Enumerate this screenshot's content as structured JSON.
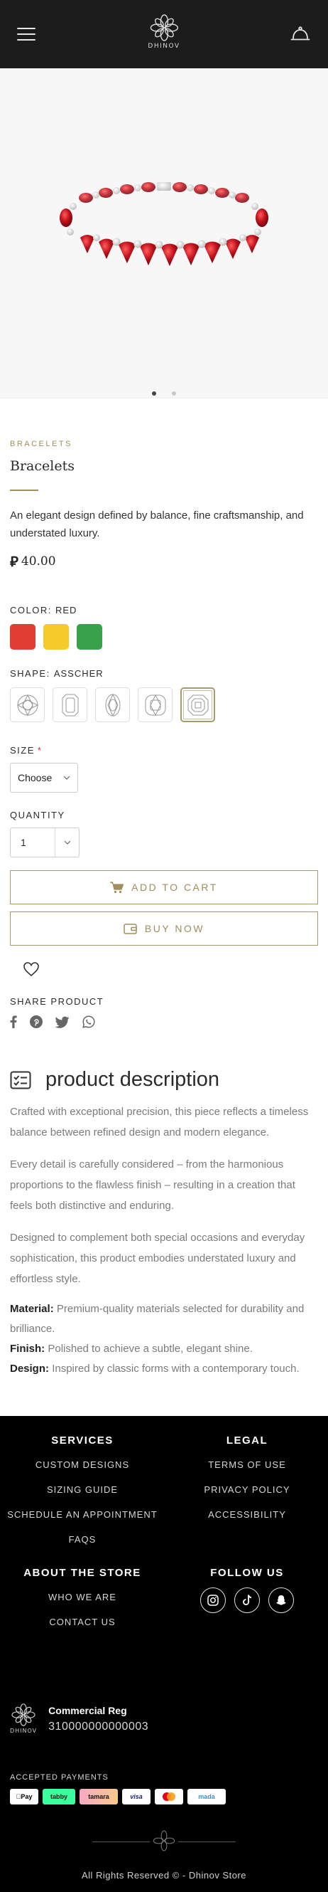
{
  "header": {
    "brand": "DHINOV"
  },
  "product": {
    "category": "BRACELETS",
    "title": "Bracelets",
    "description": "An elegant design defined by balance, fine craftsmanship, and understated luxury.",
    "currency_symbol": "⃁",
    "price": "40.00",
    "gallery": {
      "slides": 2,
      "active": 1
    },
    "color": {
      "label": "COLOR:",
      "value": "RED",
      "options": [
        "#e13d33",
        "#f5ca2a",
        "#3aa14b"
      ]
    },
    "shape": {
      "label": "SHAPE:",
      "value": "ASSCHER",
      "options": [
        "round-icon",
        "emerald-icon",
        "oval-icon",
        "cushion-icon",
        "asscher-icon"
      ]
    },
    "size": {
      "label": "SIZE",
      "required": "*",
      "value": "Choose"
    },
    "quantity": {
      "label": "QUANTITY",
      "value": "1"
    },
    "add_to_cart": "ADD TO CART",
    "buy_now": "BUY NOW",
    "share_label": "SHARE PRODUCT"
  },
  "description_section": {
    "title": "product description",
    "p1": "Crafted with exceptional precision, this piece reflects a timeless balance between refined design and modern elegance.",
    "p2": "Every detail is carefully considered – from the harmonious proportions to the flawless finish – resulting in a creation that feels both distinctive and enduring.",
    "p3": "Designed to complement both special occasions and everyday sophistication, this product embodies understated luxury and effortless style.",
    "material_label": "Material:",
    "material": "Premium-quality materials selected for durability and brilliance.",
    "finish_label": "Finish:",
    "finish": "Polished to achieve a subtle, elegant shine.",
    "design_label": "Design:",
    "design": "Inspired by classic forms with a contemporary touch."
  },
  "footer": {
    "services_title": "SERVICES",
    "services": [
      "CUSTOM DESIGNS",
      "SIZING GUIDE",
      "SCHEDULE AN APPOINTMENT",
      "FAQS"
    ],
    "legal_title": "LEGAL",
    "legal": [
      "TERMS OF USE",
      "PRIVACY POLICY",
      "ACCESSIBILITY"
    ],
    "about_title": "ABOUT THE STORE",
    "about": [
      "WHO WE ARE",
      "CONTACT US"
    ],
    "follow_title": "FOLLOW US",
    "social": [
      "instagram-icon",
      "tiktok-icon",
      "snapchat-icon"
    ],
    "brand": "DHINOV",
    "reg_label": "Commercial Reg",
    "reg_number": "310000000000003",
    "payments_label": "ACCEPTED PAYMENTS",
    "payments": [
      "Pay",
      "tabby",
      "tamara",
      "visa",
      "",
      "mada"
    ],
    "copyright": "All Rights Reserved © - Dhinov Store"
  },
  "colors": {
    "header_bg": "#1c1c1c",
    "gold": "#a08e5c",
    "footer_bg": "#000000",
    "ruby": "#b3121c"
  }
}
